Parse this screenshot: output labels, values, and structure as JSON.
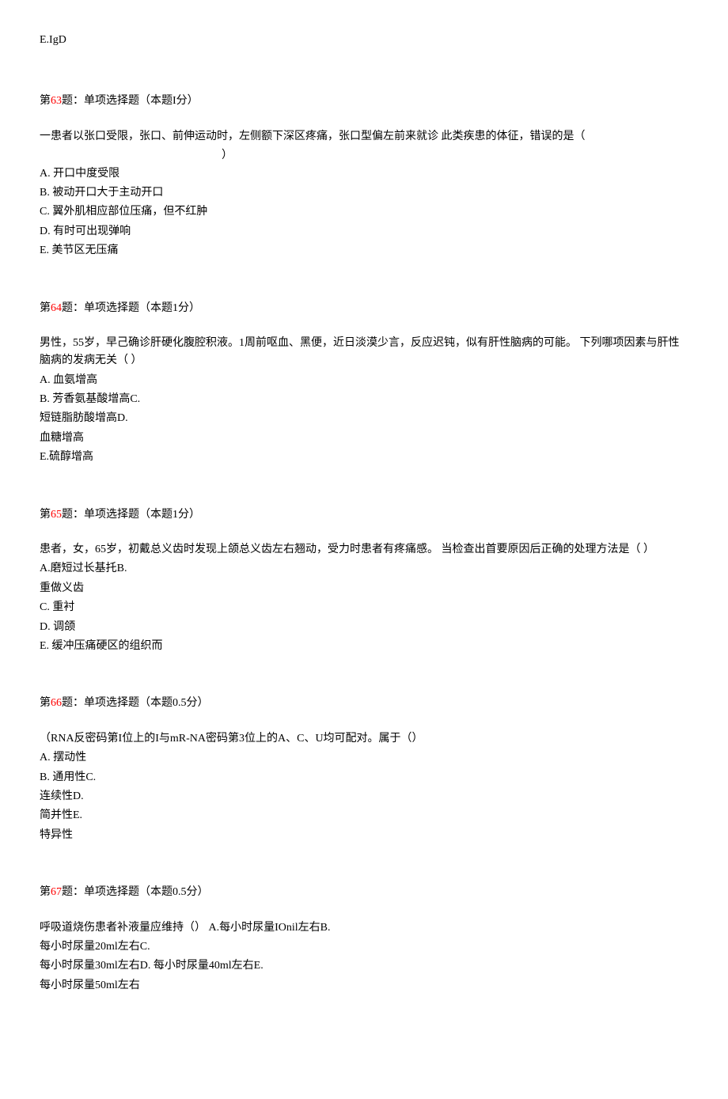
{
  "top_option": "E.IgD",
  "questions": [
    {
      "num": "63",
      "header_prefix": "第",
      "header_suffix": "题：单项选择题（本题I分）",
      "stem_line1": "一患者以张口受限，张口、前伸运动时，左侧额下深区疼痛，张口型偏左前来就诊 此类疾患的体征，错误的是（",
      "stem_line2": "）",
      "options": [
        "A.   开口中度受限",
        "B.   被动开口大于主动开口",
        "C.   翼外肌相应部位压痛，但不红肿",
        "D.   有时可出现弹响",
        "E.   美节区无压痛"
      ]
    },
    {
      "num": "64",
      "header_prefix": "第",
      "header_suffix": "题：单项选择题（本题1分）",
      "stem_line1": "男性，55岁，早己确诊肝硬化腹腔积液。1周前呕血、黑便，近日淡漠少言，反应迟钝，似有肝性脑病的可能。  下列哪项因素与肝性脑病的发病无关（             ）",
      "options": [
        "A.   血氨增高",
        "B.   芳香氨基酸增高C.",
        "短链脂肪酸增高D.",
        "血糖增高",
        "E.硫醇增高"
      ]
    },
    {
      "num": "65",
      "header_prefix": "第",
      "header_suffix": "题：单项选择题（本题1分）",
      "stem_line1": "患者，女，65岁，初戴总义齿时发现上颌总义齿左右翘动，受力时患者有疼痛感。  当检查出首要原因后正确的处理方法是（                                                      ）",
      "options": [
        "A.磨短过长基托B.",
        "重做义齿",
        "C.   重衬",
        "D.   调颌",
        "E.   缓冲压痛硬区的组织而"
      ]
    },
    {
      "num": "66",
      "header_prefix": "第",
      "header_suffix": "题：单项选择题（本题0.5分）",
      "stem_line1": "（RNA反密码第I位上的I与mR-NA密码第3位上的A、C、U均可配对。属于（）",
      "options": [
        "A.   摆动性",
        "B.   通用性C.",
        "连续性D.",
        "简并性E.",
        "特异性"
      ]
    },
    {
      "num": "67",
      "header_prefix": "第",
      "header_suffix": "题：单项选择题（本题0.5分）",
      "stem_line1": "呼吸道烧伤患者补液量应维持（）  A.每小时尿量IOnil左右B.",
      "options": [
        "每小时尿量20ml左右C.",
        "每小时尿量30ml左右D. 每小时尿量40ml左右E.",
        "每小时尿量50ml左右"
      ]
    }
  ]
}
